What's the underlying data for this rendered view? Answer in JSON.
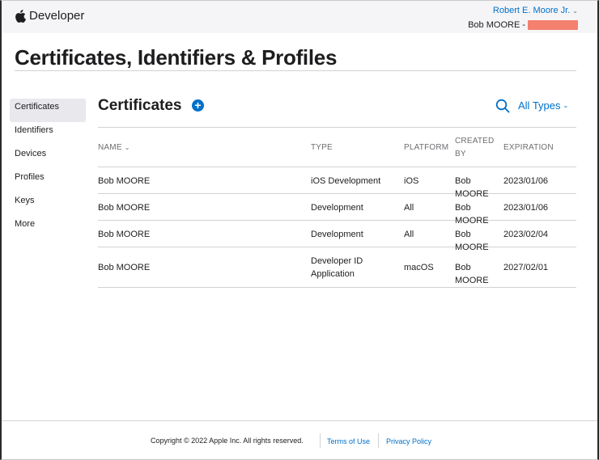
{
  "header": {
    "brand": "Developer",
    "user_name": "Robert E. Moore Jr.",
    "team_prefix": "Bob MOORE -"
  },
  "page": {
    "title": "Certificates, Identifiers & Profiles"
  },
  "sidebar": {
    "items": [
      {
        "label": "Certificates",
        "active": true
      },
      {
        "label": "Identifiers"
      },
      {
        "label": "Devices"
      },
      {
        "label": "Profiles"
      },
      {
        "label": "Keys"
      },
      {
        "label": "More"
      }
    ]
  },
  "main": {
    "section_title": "Certificates",
    "add_symbol": "+",
    "filter_label": "All Types",
    "columns": [
      "NAME",
      "TYPE",
      "PLATFORM",
      "CREATED BY",
      "EXPIRATION"
    ],
    "rows": [
      {
        "name": "Bob MOORE",
        "type": "iOS Development",
        "platform": "iOS",
        "created_by": "Bob MOORE",
        "expiration": "2023/01/06"
      },
      {
        "name": "Bob MOORE",
        "type": "Development",
        "platform": "All",
        "created_by": "Bob MOORE",
        "expiration": "2023/01/06"
      },
      {
        "name": "Bob MOORE",
        "type": "Development",
        "platform": "All",
        "created_by": "Bob MOORE",
        "expiration": "2023/02/04"
      },
      {
        "name": "Bob MOORE",
        "type": "Developer ID Application",
        "platform": "macOS",
        "created_by": "Bob MOORE",
        "expiration": "2027/02/01"
      }
    ]
  },
  "footer": {
    "copyright": "Copyright © 2022 Apple Inc. All rights reserved.",
    "links": [
      "Terms of Use",
      "Privacy Policy"
    ]
  },
  "colors": {
    "accent": "#0070c9",
    "redaction": "#f4806e",
    "header_bg": "#f5f5f7"
  }
}
